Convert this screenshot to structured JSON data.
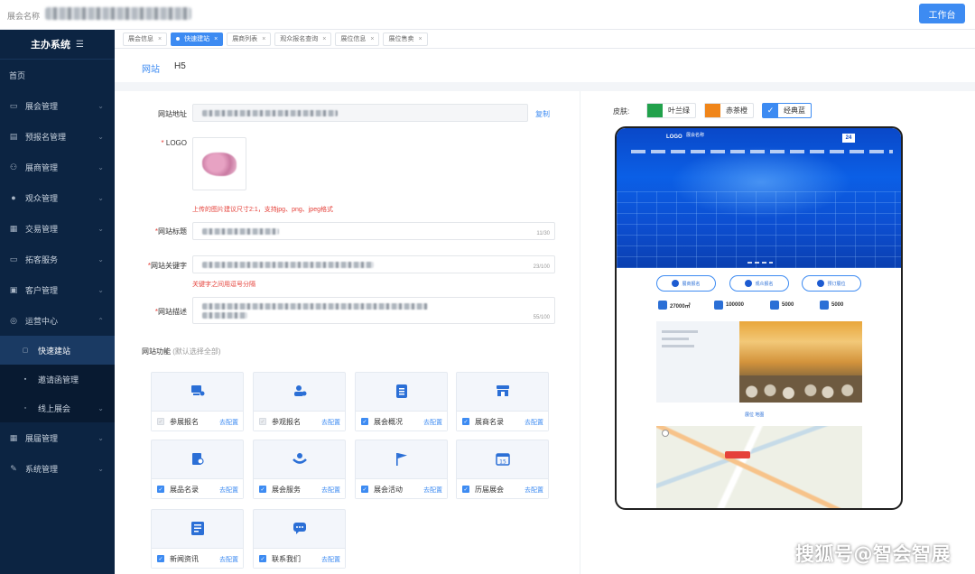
{
  "topbar": {
    "brand": "展会名称",
    "workbench_label": "工作台"
  },
  "sidebar": {
    "system_title": "主办系统",
    "collapse_icon": "menu-collapse-icon",
    "home_label": "首页",
    "items": [
      {
        "label": "展会管理",
        "icon": "monitor-icon"
      },
      {
        "label": "预报名管理",
        "icon": "clipboard-icon"
      },
      {
        "label": "展商管理",
        "icon": "users-icon"
      },
      {
        "label": "观众管理",
        "icon": "user-icon"
      },
      {
        "label": "交易管理",
        "icon": "exchange-icon"
      },
      {
        "label": "拓客服务",
        "icon": "display-icon"
      },
      {
        "label": "客户管理",
        "icon": "crm-icon"
      },
      {
        "label": "运营中心",
        "icon": "target-icon"
      }
    ],
    "sub_items": [
      {
        "label": "快速建站",
        "active": true
      },
      {
        "label": "邀请函管理",
        "active": false
      },
      {
        "label": "线上展会",
        "active": false
      }
    ],
    "bottom_items": [
      {
        "label": "展届管理",
        "icon": "grid-icon"
      },
      {
        "label": "系统管理",
        "icon": "wrench-icon"
      }
    ]
  },
  "page_tabs": [
    {
      "label": "展会信息",
      "active": false
    },
    {
      "label": "快速建站",
      "active": true
    },
    {
      "label": "展商列表",
      "active": false
    },
    {
      "label": "观众报名查询",
      "active": false
    },
    {
      "label": "展位信息",
      "active": false
    },
    {
      "label": "展位售卖",
      "active": false
    }
  ],
  "sub_tabs": [
    {
      "label": "网站",
      "active": true
    },
    {
      "label": "H5",
      "active": false
    }
  ],
  "form": {
    "site_address_label": "网站地址",
    "copy_label": "复制",
    "logo_label": "LOGO",
    "logo_hint": "上传的图片建议尺寸2:1，支持jpg、png、jpeg格式",
    "title_label": "网站标题",
    "title_counter": "11/30",
    "keywords_label": "网站关键字",
    "keywords_counter": "23/100",
    "keywords_hint": "关键字之间用逗号分隔",
    "desc_label": "网站描述",
    "desc_counter": "55/100"
  },
  "features": {
    "title": "网站功能",
    "subtitle": "(默认选择全部)",
    "config_label": "去配置",
    "items": [
      {
        "name": "参展报名",
        "checked": false,
        "icon": "booth-register-icon"
      },
      {
        "name": "参观报名",
        "checked": false,
        "icon": "visitor-register-icon"
      },
      {
        "name": "展会概况",
        "checked": true,
        "icon": "document-icon"
      },
      {
        "name": "展商名录",
        "checked": true,
        "icon": "store-icon"
      },
      {
        "name": "展品名录",
        "checked": true,
        "icon": "exhibit-icon"
      },
      {
        "name": "展会服务",
        "checked": true,
        "icon": "service-icon"
      },
      {
        "name": "展会活动",
        "checked": true,
        "icon": "flag-icon"
      },
      {
        "name": "历届展会",
        "checked": true,
        "icon": "calendar-icon"
      },
      {
        "name": "新闻资讯",
        "checked": true,
        "icon": "news-icon"
      },
      {
        "name": "联系我们",
        "checked": true,
        "icon": "chat-icon"
      }
    ]
  },
  "skin": {
    "label": "皮肤:",
    "options": [
      {
        "name": "叶兰绿",
        "color": "#21a14b",
        "selected": false
      },
      {
        "name": "赤茶橙",
        "color": "#f08519",
        "selected": false
      },
      {
        "name": "经典蓝",
        "color": "#3d8bf2",
        "selected": true
      }
    ]
  },
  "preview": {
    "logo": "LOGO",
    "site_name": "展会名称",
    "badge": "24",
    "buttons": [
      "展商报名",
      "观众报名",
      "预订展位"
    ],
    "stats": [
      "27000㎡",
      "100000",
      "5000",
      "5000"
    ],
    "caption": "展位 地图"
  },
  "watermark": "搜狐号@智会智展",
  "colors": {
    "accent": "#3d8bf2",
    "sidebar": "#0c2442",
    "error": "#e5413a"
  }
}
